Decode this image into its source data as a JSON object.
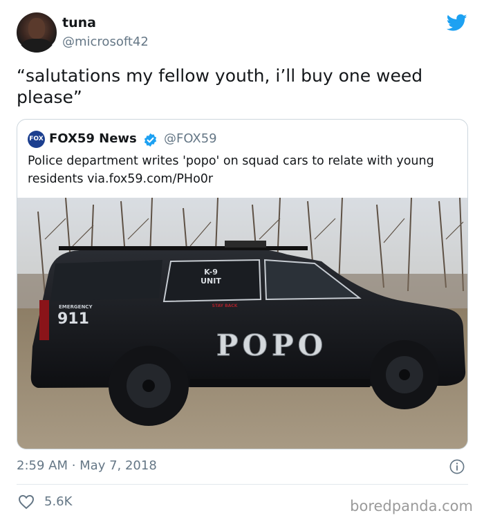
{
  "tweet": {
    "display_name": "tuna",
    "handle": "@microsoft42",
    "text": "“salutations my fellow youth, i’ll buy one weed please”",
    "timestamp": "2:59 AM · May 7, 2018",
    "likes": "5.6K"
  },
  "quoted_tweet": {
    "logo_text": "FOX 59",
    "name": "FOX59 News",
    "handle": "@FOX59",
    "text": "Police department writes 'popo' on squad cars to relate with young residents via.fox59.com/PHo0r",
    "image": {
      "unit_label_1": "K-9",
      "unit_label_2": "UNIT",
      "stay_back": "STAY BACK",
      "emergency": "EMERGENCY",
      "emergency_number": "911",
      "door_text": "POPO"
    }
  },
  "icons": {
    "brand": "twitter-bird-icon",
    "verified": "verified-badge-icon",
    "info": "info-icon",
    "like": "heart-icon"
  },
  "colors": {
    "twitter_blue": "#1da1f2",
    "secondary_text": "#657786",
    "border": "#ccd6dd"
  },
  "watermark": "boredpanda.com"
}
